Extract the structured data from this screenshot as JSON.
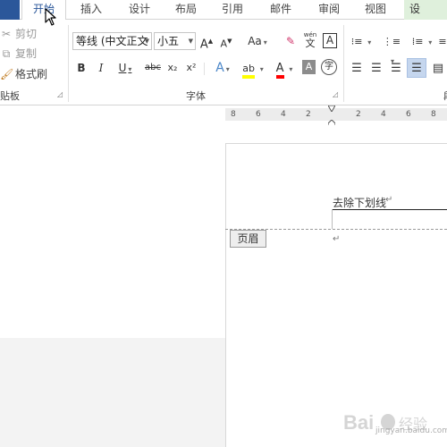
{
  "tabs": {
    "home": "开始",
    "insert": "插入",
    "design": "设计",
    "layout": "布局",
    "references": "引用",
    "mailings": "邮件",
    "review": "审阅",
    "view": "视图",
    "settings": "设"
  },
  "clipboard": {
    "cut": "剪切",
    "copy": "复制",
    "format_painter": "格式刷",
    "group_label": "贴板"
  },
  "font": {
    "font_name": "等线 (中文正文",
    "font_size": "小五",
    "grow": "A",
    "shrink": "A",
    "change_case": "Aa",
    "phonetic_top": "wén",
    "phonetic_bottom": "文",
    "char_border": "A",
    "bold": "B",
    "italic": "I",
    "underline": "U",
    "strikethrough": "abc",
    "subscript": "x₂",
    "superscript": "x²",
    "text_effect": "A",
    "font_color": "A",
    "char_shading": "A",
    "enclose": "字",
    "group_label": "字体"
  },
  "ruler": {
    "ticks_left": [
      "8",
      "6",
      "4",
      "2"
    ],
    "ticks_right": [
      "2",
      "4",
      "6",
      "8"
    ]
  },
  "document": {
    "header_text": "去除下划线",
    "paragraph_mark": "↵",
    "header_tag": "页眉"
  },
  "watermark": {
    "text": "Bai 经验",
    "sub": "jingyan.baidu.com"
  },
  "colors": {
    "accent": "#2b579a",
    "highlight": "#ffff00",
    "font_color": "#ff0000"
  }
}
